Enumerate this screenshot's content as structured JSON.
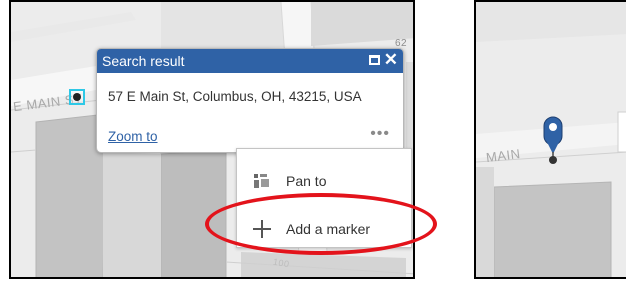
{
  "left_map": {
    "street_label": "E MAIN ST",
    "street_number_badge": "62",
    "street_number_bottom": "100"
  },
  "popup": {
    "title": "Search result",
    "address": "57 E Main St, Columbus, OH, 43215, USA",
    "zoom_label": "Zoom to",
    "more_label": "•••",
    "maximize_icon": "maximize-icon",
    "close_icon": "close-icon",
    "header_color": "#2f62a6"
  },
  "context_menu": {
    "items": [
      {
        "label": "Pan to",
        "icon": "pan-icon"
      },
      {
        "label": "Add a marker",
        "icon": "plus-icon"
      }
    ]
  },
  "right_map": {
    "street_label": "MAIN",
    "marker_color": "#2f62a6"
  },
  "annotation": {
    "color": "#e3131b"
  }
}
